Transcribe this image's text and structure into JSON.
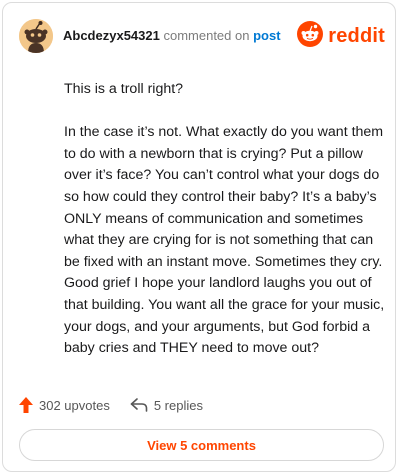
{
  "header": {
    "username": "Abcdezyx54321",
    "action_text": "commented on",
    "target_text": "post",
    "logo_text": "reddit"
  },
  "comment": {
    "paragraphs": [
      "This is a troll right?",
      "In the case it’s not. What exactly do you want them to do with a newborn that is crying? Put a pillow over it’s face? You can’t control what your dogs do so how could they control their baby? It’s a baby’s ONLY means of communication and sometimes what they are crying for is not something that can be fixed with an instant move. Sometimes they cry. Good grief I hope your landlord laughs you out of that building. You want all the grace for your music, your dogs, and your arguments, but God forbid a baby cries and THEY need to move out?"
    ]
  },
  "stats": {
    "upvotes_label": "302 upvotes",
    "replies_label": "5 replies"
  },
  "footer": {
    "view_comments_label": "View 5 comments"
  },
  "icons": {
    "avatar": "snoo-avatar-icon",
    "logo": "reddit-logo-icon",
    "upvote": "upvote-arrow-icon",
    "reply": "reply-arrow-icon"
  },
  "colors": {
    "brand_orange": "#ff4500",
    "link_blue": "#0079d3",
    "text": "#1a1a1b",
    "muted": "#7c7c7c",
    "card_border": "#dcdcdc"
  }
}
